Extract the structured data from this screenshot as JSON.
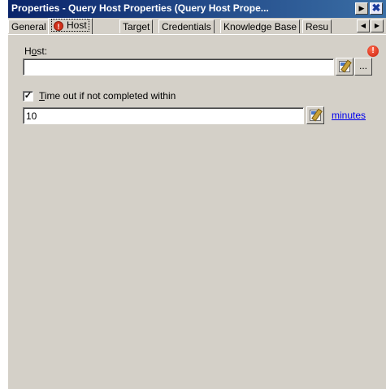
{
  "window": {
    "title": "Properties - Query Host Properties (Query Host Prope...",
    "arrow_glyph": "▶",
    "close_glyph": "✖"
  },
  "tabs": [
    {
      "label": "General",
      "active": false
    },
    {
      "label": "Host",
      "active": true,
      "icon": "error-alert-icon"
    },
    {
      "label": "Target",
      "active": false
    },
    {
      "label": "Credentials",
      "active": false
    },
    {
      "label": "Knowledge Base",
      "active": false
    },
    {
      "label": "Resu",
      "active": false
    }
  ],
  "tab_scroll": {
    "left_glyph": "◀",
    "right_glyph": "▶"
  },
  "host": {
    "label_pre": "H",
    "label_mnemonic": "o",
    "label_post": "st:",
    "value": "",
    "alert_glyph": "!",
    "browse_label": "..."
  },
  "timeout": {
    "checked": true,
    "check_glyph": "✓",
    "label_mnemonic": "T",
    "label_rest": "ime out if not completed within",
    "value": "10",
    "units_link": "minutes"
  },
  "colors": {
    "titlebar_start": "#0a246a",
    "titlebar_end": "#3a6ea5",
    "dialog_bg": "#d4d0c8",
    "alert": "#d2301b",
    "link": "#0000ee"
  }
}
